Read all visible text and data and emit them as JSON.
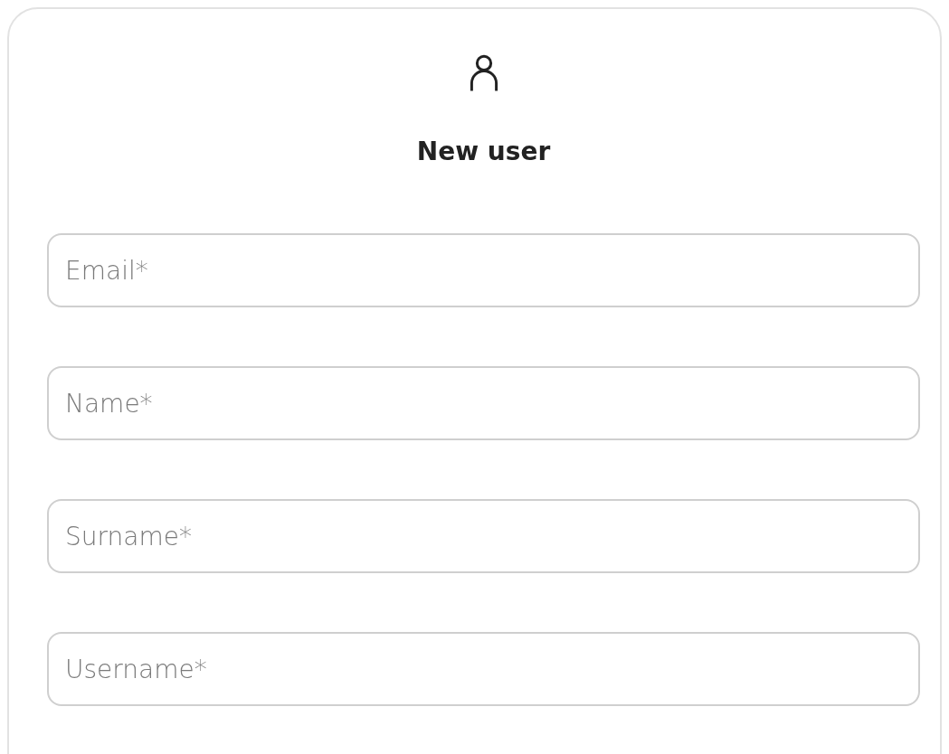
{
  "title": "New user",
  "fields": [
    {
      "placeholder": "Email*"
    },
    {
      "placeholder": "Name*"
    },
    {
      "placeholder": "Surname*"
    },
    {
      "placeholder": "Username*"
    }
  ]
}
